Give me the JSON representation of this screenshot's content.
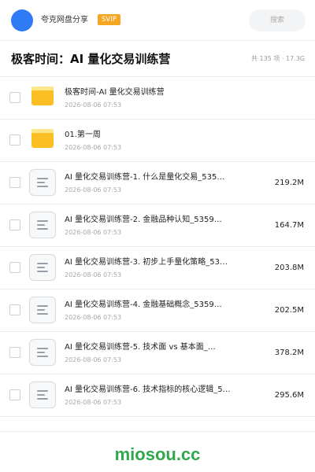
{
  "topbar": {
    "user_name": "夸克网盘分享",
    "badge": "SVIP",
    "search_placeholder": "搜索"
  },
  "header": {
    "title": "极客时间：AI 量化交易训练营",
    "summary": "共 135 项 · 17.3G"
  },
  "files": [
    {
      "type": "folder",
      "name": "极客时间-AI 量化交易训练营",
      "date": "2026-08-06 07:53",
      "size": ""
    },
    {
      "type": "folder",
      "name": "01.第一周",
      "date": "2026-08-06 07:53",
      "size": ""
    },
    {
      "type": "file",
      "name": "AI 量化交易训练营-1. 什么是量化交易_535…",
      "date": "2026-08-06 07:53",
      "size": "219.2M"
    },
    {
      "type": "file",
      "name": "AI 量化交易训练营-2. 金融品种认知_5359…",
      "date": "2026-08-06 07:53",
      "size": "164.7M"
    },
    {
      "type": "file",
      "name": "AI 量化交易训练营-3. 初步上手量化策略_53…",
      "date": "2026-08-06 07:53",
      "size": "203.8M"
    },
    {
      "type": "file",
      "name": "AI 量化交易训练营-4. 金融基础概念_5359…",
      "date": "2026-08-06 07:53",
      "size": "202.5M"
    },
    {
      "type": "file",
      "name": "AI 量化交易训练营-5. 技术面 vs 基本面_…",
      "date": "2026-08-06 07:53",
      "size": "378.2M"
    },
    {
      "type": "file",
      "name": "AI 量化交易训练营-6. 技术指标的核心逻辑_5…",
      "date": "2026-08-06 07:53",
      "size": "295.6M"
    }
  ],
  "watermark": "miosou.cc",
  "colors": {
    "avatar": "#2f7bf5",
    "svip": "#f5a623",
    "folder": "#fbbf24",
    "watermark": "#2ea84a"
  }
}
